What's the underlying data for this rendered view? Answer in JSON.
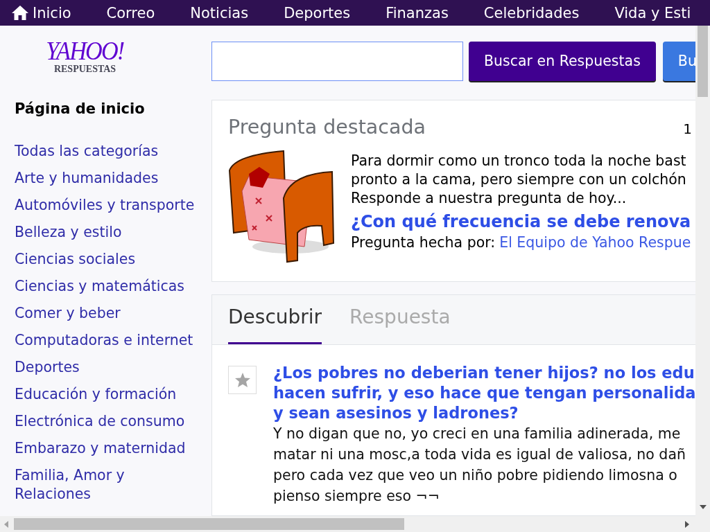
{
  "nav": [
    {
      "label": "Inicio",
      "kind": "home"
    },
    {
      "label": "Correo",
      "kind": "link"
    },
    {
      "label": "Noticias",
      "kind": "link"
    },
    {
      "label": "Deportes",
      "kind": "link"
    },
    {
      "label": "Finanzas",
      "kind": "link"
    },
    {
      "label": "Celebridades",
      "kind": "link"
    },
    {
      "label": "Vida y Esti",
      "kind": "link"
    }
  ],
  "logo": {
    "brand": "YAHOO!",
    "sub": "RESPUESTAS"
  },
  "search": {
    "buttons": [
      {
        "label": "Buscar en Respuestas",
        "kind": "primary"
      },
      {
        "label": "Bu",
        "kind": "secondary"
      }
    ]
  },
  "sidebar": {
    "heading": "Página de inicio",
    "items": [
      "Todas las categorías",
      "Arte y humanidades",
      "Automóviles y transporte",
      "Belleza y estilo",
      "Ciencias sociales",
      "Ciencias y matemáticas",
      "Comer y beber",
      "Computadoras e internet",
      "Deportes",
      "Educación y formación",
      "Electrónica de consumo",
      "Embarazo y maternidad",
      "Familia, Amor y Relaciones"
    ]
  },
  "featured": {
    "title": "Pregunta destacada",
    "counter": "1",
    "lines": [
      "Para dormir como un tronco toda la noche bast",
      "pronto a la cama, pero siempre con un colchón",
      "Responde a nuestra pregunta de hoy..."
    ],
    "question": "¿Con qué frecuencia se debe renova",
    "asked_by_label": "Pregunta hecha por:",
    "asked_by": "El Equipo de Yahoo Respue"
  },
  "tabs": [
    {
      "label": "Descubrir",
      "selected": true
    },
    {
      "label": "Respuesta",
      "selected": false
    }
  ],
  "questions": [
    {
      "title_lines": [
        "¿Los pobres no deberian tener hijos? no los edu",
        "hacen sufrir, y eso hace que tengan personalida",
        "y sean asesinos y ladrones?"
      ],
      "body_lines": [
        "Y no digan que no, yo creci en una familia adinerada, me",
        "matar ni una mosc,a toda vida es igual de valiosa, no dañ",
        "pero cada vez que veo un niño pobre pidiendo limosna o",
        "pienso siempre eso ¬¬"
      ]
    }
  ]
}
